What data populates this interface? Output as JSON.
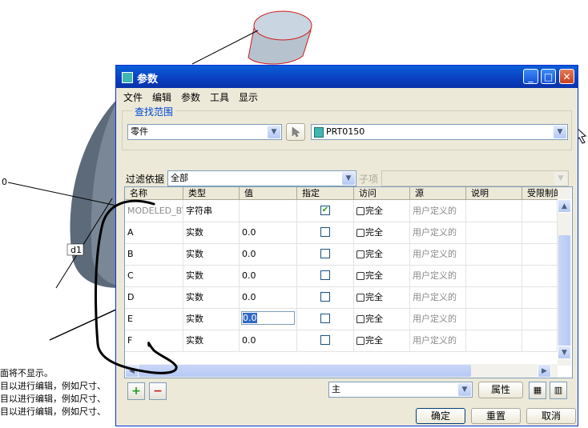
{
  "dialog": {
    "title": "参数",
    "menu": [
      "文件",
      "编辑",
      "参数",
      "工具",
      "显示"
    ],
    "search_scope_label": "查找范围",
    "scope_value": "零件",
    "model_value": "PRT0150",
    "filter_label": "过滤依据",
    "filter_value": "全部",
    "subitem_label": "子项",
    "columns": [
      "名称",
      "类型",
      "值",
      "指定",
      "访问",
      "源",
      "说明",
      "受限制的"
    ],
    "rows": [
      {
        "name": "MODELED_BY",
        "type": "字符串",
        "value": "",
        "designated": true,
        "access": "完全",
        "source": "用户定义的"
      },
      {
        "name": "A",
        "type": "实数",
        "value": "0.0",
        "designated": false,
        "access": "完全",
        "source": "用户定义的"
      },
      {
        "name": "B",
        "type": "实数",
        "value": "0.0",
        "designated": false,
        "access": "完全",
        "source": "用户定义的"
      },
      {
        "name": "C",
        "type": "实数",
        "value": "0.0",
        "designated": false,
        "access": "完全",
        "source": "用户定义的"
      },
      {
        "name": "D",
        "type": "实数",
        "value": "0.0",
        "designated": false,
        "access": "完全",
        "source": "用户定义的"
      },
      {
        "name": "E",
        "type": "实数",
        "value": "0.0",
        "designated": false,
        "access": "完全",
        "source": "用户定义的"
      },
      {
        "name": "F",
        "type": "实数",
        "value": "0.0",
        "designated": false,
        "access": "完全",
        "source": "用户定义的"
      }
    ],
    "main_combo": "主",
    "properties_label": "属性",
    "ok_label": "确定",
    "reset_label": "重置",
    "cancel_label": "取消"
  },
  "background": {
    "messages": [
      "面将不显示。",
      "目以进行编辑，例如尺寸、",
      "目以进行编辑，例如尺寸、",
      "目以进行编辑，例如尺寸、"
    ],
    "dim_label": "d1",
    "dim_zero": "0"
  }
}
